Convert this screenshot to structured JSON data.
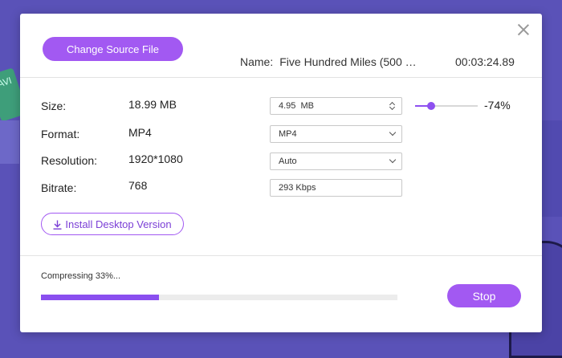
{
  "background": {
    "decor_text": "AVI"
  },
  "dialog": {
    "change_source_label": "Change Source File",
    "name_label": "Name:",
    "name_value": "Five Hundred Miles (500 …",
    "duration": "00:03:24.89"
  },
  "info": {
    "size_label": "Size:",
    "size_value": "18.99 MB",
    "format_label": "Format:",
    "format_value": "MP4",
    "resolution_label": "Resolution:",
    "resolution_value": "1920*1080",
    "bitrate_label": "Bitrate:",
    "bitrate_value": "768"
  },
  "output": {
    "size_value": "4.95  MB",
    "format_value": "MP4",
    "resolution_value": "Auto",
    "bitrate_value": "293 Kbps",
    "compression_percent": "-74%",
    "slider_fraction": 0.26
  },
  "install_label": "Install Desktop Version",
  "progress": {
    "status": "Compressing 33%...",
    "fraction": 0.33
  },
  "stop_label": "Stop",
  "colors": {
    "accent": "#a259f2",
    "background": "#5a52b8"
  },
  "icons": {
    "close": "close-icon",
    "download": "download-icon",
    "chevron": "chevron-down-icon",
    "stepper": "stepper-icon"
  }
}
